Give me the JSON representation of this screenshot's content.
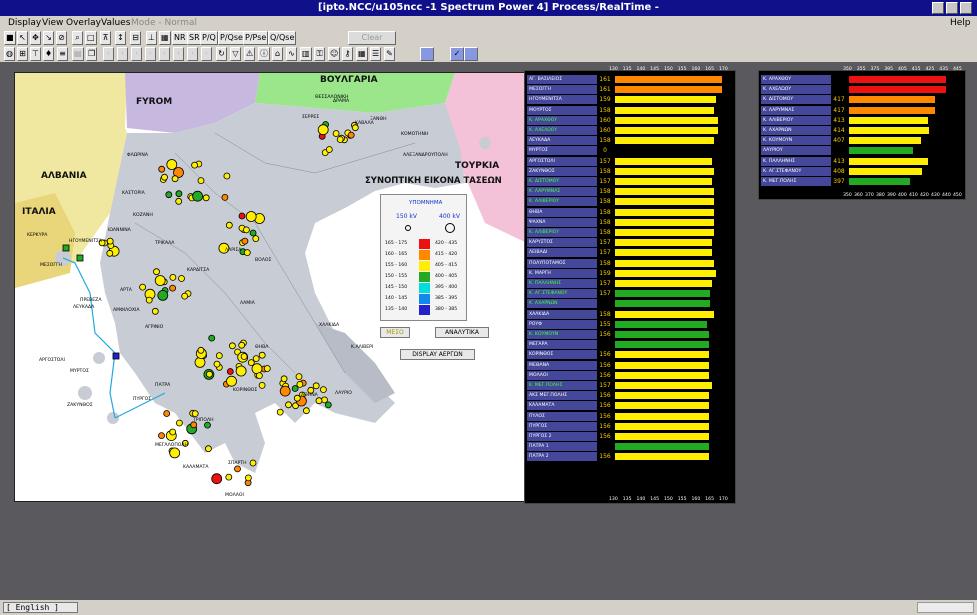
{
  "window": {
    "title": "[ipto.NCC/u105ncc -1   Spectrum Power 4]   Process/RealTime -"
  },
  "menu": {
    "display": "Display",
    "view": "View",
    "overlay": "Overlay",
    "values": "Values",
    "mode": "Mode - Normal",
    "help": "Help"
  },
  "toolbar": {
    "nr": "NR",
    "sr": "SR",
    "pq": "P/Q",
    "pqse": "P/Qse",
    "ppse": "P/Pse",
    "qqse": "Q/Qse",
    "clear_hilight": "Clear Hilight"
  },
  "map": {
    "countries": {
      "bulgaria": "ΒΟΥΛΓΑΡΙΑ",
      "fyrom": "FYROM",
      "albania": "ΑΛΒΑΝΙΑ",
      "italy": "ΙΤΑΛΙΑ",
      "turkey": "ΤΟΥΡΚΙΑ"
    },
    "title": "ΣΥΝΟΠΤΙΚΗ ΕΙΚΟΝΑ ΤΑΣΕΩΝ",
    "legend": {
      "title": "ΥΠΟΜΝΗΜΑ",
      "kv150": "150 kV",
      "kv400": "400 kV",
      "ranges_150": [
        "165 - 175",
        "160 - 165",
        "155 - 160",
        "150 - 155",
        "145 - 150",
        "140 - 145",
        "135 - 140"
      ],
      "ranges_400": [
        "420 - 435",
        "415 - 420",
        "405 - 415",
        "400 - 405",
        "395 - 400",
        "385 - 395",
        "380 - 385"
      ],
      "colors": [
        "#ee1111",
        "#ff8800",
        "#ffee00",
        "#22aa22",
        "#00dddd",
        "#1188ee",
        "#2222cc"
      ]
    },
    "buttons": {
      "mid": "ΜΕΣΟ",
      "analytic": "ΑΝΑΛΥΤΙΚΑ",
      "works": "DISPLAY ΑΕΡΓΩΝ"
    },
    "labels": [
      "ΘΕΣΣΑΛΟΝΙΚΗ",
      "ΚΑΒΑΛΑ",
      "ΚΟΜΟΤΗΝΗ",
      "ΞΑΝΘΗ",
      "ΔΡΑΜΑ",
      "ΣΕΡΡΕΣ",
      "ΑΛΕΞΑΝΔΡΟΥΠΟΛΗ",
      "ΦΛΩΡΙΝΑ",
      "ΚΑΣΤΟΡΙΑ",
      "ΚΟΖΑΝΗ",
      "ΙΩΑΝΝΙΝΑ",
      "ΚΕΡΚΥΡΑ",
      "ΗΓΟΥΜΕΝΙΤΣΑ",
      "ΜΕΣΟΓΓΗ",
      "ΛΑΡΙΣΑ",
      "ΒΟΛΟΣ",
      "ΤΡΙΚΑΛΑ",
      "ΚΑΡΔΙΤΣΑ",
      "ΛΑΜΙΑ",
      "ΑΡΤΑ",
      "ΠΡΕΒΕΖΑ",
      "ΑΓΡΙΝΙΟ",
      "ΛΕΥΚΑΔΑ",
      "ΜΥΡΤΟΣ",
      "ΑΡΓΟΣΤΟΛΙ",
      "ΖΑΚΥΝΘΟΣ",
      "ΠΑΤΡΑ",
      "ΠΥΡΓΟΣ",
      "ΚΟΡΙΝΘΟΣ",
      "ΤΡΙΠΟΛΗ",
      "ΚΑΛΑΜΑΤΑ",
      "ΣΠΑΡΤΗ",
      "ΜΟΛΑΟΙ",
      "ΑΘΗΝΑ",
      "ΛΑΥΡΙΟ",
      "Κ.ΑΛΙΒΕΡΙ",
      "ΧΑΛΚΙΔΑ",
      "ΘΗΒΑ",
      "ΜΕΓΑΛΟΠΟΛΗ",
      "ΑΜΦΙΛΟΧΙΑ"
    ]
  },
  "panel1": {
    "axis": [
      "130",
      "135",
      "140",
      "145",
      "150",
      "155",
      "160",
      "165",
      "170"
    ],
    "rows": [
      {
        "name": "ΑΓ. ΒΑΣΙΛΕΙΟΣ",
        "value": "161",
        "color": "#ff8800",
        "ratio": 0.97
      },
      {
        "name": "ΜΕΣΟΓΓΗ",
        "value": "161",
        "color": "#ff8800",
        "ratio": 0.97
      },
      {
        "name": "ΗΓΟΥΜΕΝΙΤΣΑ",
        "value": "159",
        "color": "#ffee00",
        "ratio": 0.92
      },
      {
        "name": "ΜΟΥΡΤΟΣ",
        "value": "158",
        "color": "#ffee00",
        "ratio": 0.9
      },
      {
        "name": "Κ. ΑΡΑΧΘΟΥ",
        "value": "160",
        "color": "#ffee00",
        "ratio": 0.94,
        "green": true
      },
      {
        "name": "Κ. ΑΧΕΛΩΟΥ",
        "value": "160",
        "color": "#ffee00",
        "ratio": 0.94,
        "green": true
      },
      {
        "name": "ΛΕΥΚΑΔΑ",
        "value": "158",
        "color": "#ffee00",
        "ratio": 0.9
      },
      {
        "name": "ΜΥΡΤΟΣ",
        "value": "0",
        "color": "#000000",
        "ratio": 0
      },
      {
        "name": "ΑΡΓΟΣΤΟΛΙ",
        "value": "157",
        "color": "#ffee00",
        "ratio": 0.88
      },
      {
        "name": "ΖΑΚΥΝΘΟΣ",
        "value": "158",
        "color": "#ffee00",
        "ratio": 0.9
      },
      {
        "name": "Κ. ΔΙΣΤΟΜΟΥ",
        "value": "157",
        "color": "#ffee00",
        "ratio": 0.88,
        "green": true
      },
      {
        "name": "Κ. ΛΑΡΥΜΝΑΣ",
        "value": "158",
        "color": "#ffee00",
        "ratio": 0.9,
        "green": true
      },
      {
        "name": "Κ. ΑΛΙΒΕΡΙΟΥ",
        "value": "158",
        "color": "#ffee00",
        "ratio": 0.9,
        "green": true
      },
      {
        "name": "ΘΗΒΑ",
        "value": "158",
        "color": "#ffee00",
        "ratio": 0.9
      },
      {
        "name": "ΨΑΧΝΑ",
        "value": "158",
        "color": "#ffee00",
        "ratio": 0.9
      },
      {
        "name": "Κ. ΑΛΙΒΕΡΙΟΥ",
        "value": "158",
        "color": "#ffee00",
        "ratio": 0.9,
        "green": true
      },
      {
        "name": "ΚΑΡΥΣΤΟΣ",
        "value": "157",
        "color": "#ffee00",
        "ratio": 0.88
      },
      {
        "name": "ΛΕΙΒΑΔΙ",
        "value": "157",
        "color": "#ffee00",
        "ratio": 0.88
      },
      {
        "name": "ΠΟΛΥΠΟΤΑΜΟΣ",
        "value": "158",
        "color": "#ffee00",
        "ratio": 0.9
      },
      {
        "name": "Κ. ΜΑΡΓΗ",
        "value": "159",
        "color": "#ffee00",
        "ratio": 0.92
      },
      {
        "name": "Κ. ΠΑΛΛΗΝΗΣ",
        "value": "157",
        "color": "#ffee00",
        "ratio": 0.88,
        "green": true
      },
      {
        "name": "Κ. ΑΓ.ΣΤΕΦΑΝΟΥ",
        "value": "157",
        "color": "#22aa22",
        "ratio": 0.86,
        "green": true
      },
      {
        "name": "Κ. ΑΧΑΡΝΩΝ",
        "value": "",
        "color": "#22aa22",
        "ratio": 0.86,
        "green": true
      },
      {
        "name": "ΧΑΛΚΙΔΑ",
        "value": "158",
        "color": "#ffee00",
        "ratio": 0.9
      },
      {
        "name": "ΡΟΥΦ",
        "value": "155",
        "color": "#22aa22",
        "ratio": 0.84
      },
      {
        "name": "Κ. ΚΟΥΜΟΥΝ",
        "value": "156",
        "color": "#22aa22",
        "ratio": 0.85,
        "green": true
      },
      {
        "name": "ΜΕΓΑΡΑ",
        "value": "",
        "color": "#22aa22",
        "ratio": 0.85
      },
      {
        "name": "ΚΟΡΙΝΘΟΣ",
        "value": "156",
        "color": "#ffee00",
        "ratio": 0.85
      },
      {
        "name": "ΜΕΘΑΝΑ",
        "value": "156",
        "color": "#ffee00",
        "ratio": 0.85
      },
      {
        "name": "ΜΟΛΑΟΙ",
        "value": "156",
        "color": "#ffee00",
        "ratio": 0.85
      },
      {
        "name": "Κ. ΜΕΓ.ΠΟΛΗΣ",
        "value": "157",
        "color": "#ffee00",
        "ratio": 0.88,
        "green": true
      },
      {
        "name": "ΑΚΣ ΜΕΓ.ΠΟΛΗΣ",
        "value": "156",
        "color": "#ffee00",
        "ratio": 0.85
      },
      {
        "name": "ΚΑΛΑΜΑΤΑ",
        "value": "156",
        "color": "#ffee00",
        "ratio": 0.85
      },
      {
        "name": "ΠΥΛΟΣ",
        "value": "156",
        "color": "#ffee00",
        "ratio": 0.85
      },
      {
        "name": "ΠΥΡΓΟΣ",
        "value": "156",
        "color": "#ffee00",
        "ratio": 0.85
      },
      {
        "name": "ΠΥΡΓΟΣ 2",
        "value": "156",
        "color": "#ffee00",
        "ratio": 0.85
      },
      {
        "name": "ΠΑΤΡΑ 1",
        "value": "",
        "color": "#22aa22",
        "ratio": 0.85
      },
      {
        "name": "ΠΑΤΡΑ 2",
        "value": "156",
        "color": "#ffee00",
        "ratio": 0.85
      }
    ]
  },
  "panel2": {
    "axis_top": [
      "350",
      "355",
      "375",
      "395",
      "405",
      "415",
      "425",
      "435",
      "445"
    ],
    "axis_bottom": [
      "350",
      "360",
      "370",
      "380",
      "390",
      "400",
      "410",
      "420",
      "430",
      "440",
      "450"
    ],
    "rows": [
      {
        "name": "Κ. ΑΡΑΧΘΟΥ",
        "value": "",
        "color": "#ee1111",
        "ratio": 0.88
      },
      {
        "name": "Κ. ΑΧΕΛΩΟΥ",
        "value": "",
        "color": "#ee1111",
        "ratio": 0.88
      },
      {
        "name": "Κ. ΔΙΣΤΟΜΟΥ",
        "value": "417",
        "color": "#ff8800",
        "ratio": 0.78
      },
      {
        "name": "Κ. ΛΑΡΥΜΝΑΣ",
        "value": "417",
        "color": "#ff8800",
        "ratio": 0.78
      },
      {
        "name": "Κ. ΑΛΙΒΕΡΙΟΥ",
        "value": "413",
        "color": "#ffee00",
        "ratio": 0.72
      },
      {
        "name": "Κ. ΑΧΑΡΝΩΝ",
        "value": "414",
        "color": "#ffee00",
        "ratio": 0.73
      },
      {
        "name": "Κ. ΚΟΥΜΟΥΝ",
        "value": "407",
        "color": "#ffee00",
        "ratio": 0.65
      },
      {
        "name": "ΛΑΥΡΙΟΥ",
        "value": "",
        "color": "#22aa22",
        "ratio": 0.58
      },
      {
        "name": "Κ. ΠΑΛΛΗΝΗΣ",
        "value": "413",
        "color": "#ffee00",
        "ratio": 0.72
      },
      {
        "name": "Κ. ΑΓ.ΣΤΕΦΑΝΟΥ",
        "value": "408",
        "color": "#ffee00",
        "ratio": 0.66
      },
      {
        "name": "Κ. ΜΕΓ.ΠΟΛΗΣ",
        "value": "397",
        "color": "#22aa22",
        "ratio": 0.55
      }
    ]
  },
  "status": {
    "lang": "[ English ]"
  }
}
